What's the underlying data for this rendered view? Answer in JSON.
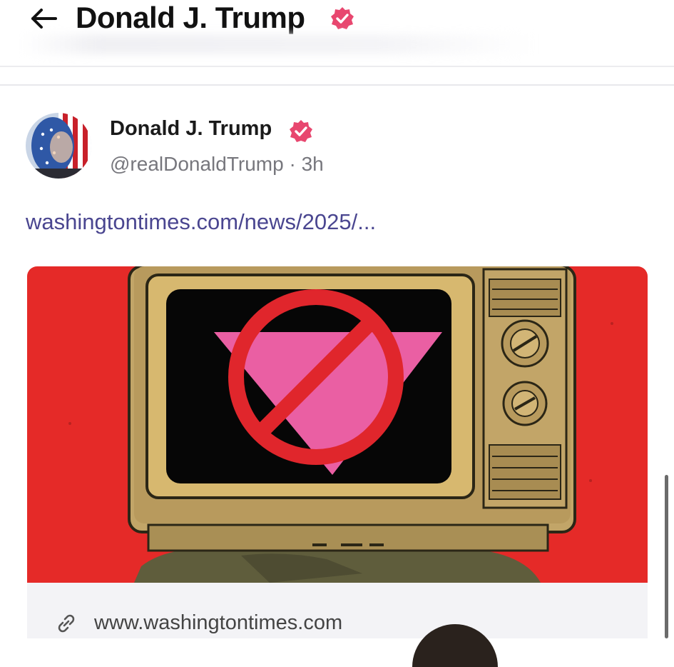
{
  "header": {
    "title": "Donald J. Trump",
    "back_icon": "arrow-left-icon",
    "verified_icon": "verified-badge-icon"
  },
  "post": {
    "author_name": "Donald J. Trump",
    "author_handle": "@realDonaldTrump",
    "time": "· 3h",
    "link_text": "washingtontimes.com/news/2025/...",
    "verified_icon": "verified-badge-icon"
  },
  "link_card": {
    "domain": "www.washingtontimes.com",
    "link_icon": "link-icon"
  },
  "colors": {
    "verified": "#e8476f",
    "link": "#4a4690",
    "image_background": "#e52a28",
    "triangle": "#ea5fa3",
    "prohibition": "#e0262c"
  }
}
